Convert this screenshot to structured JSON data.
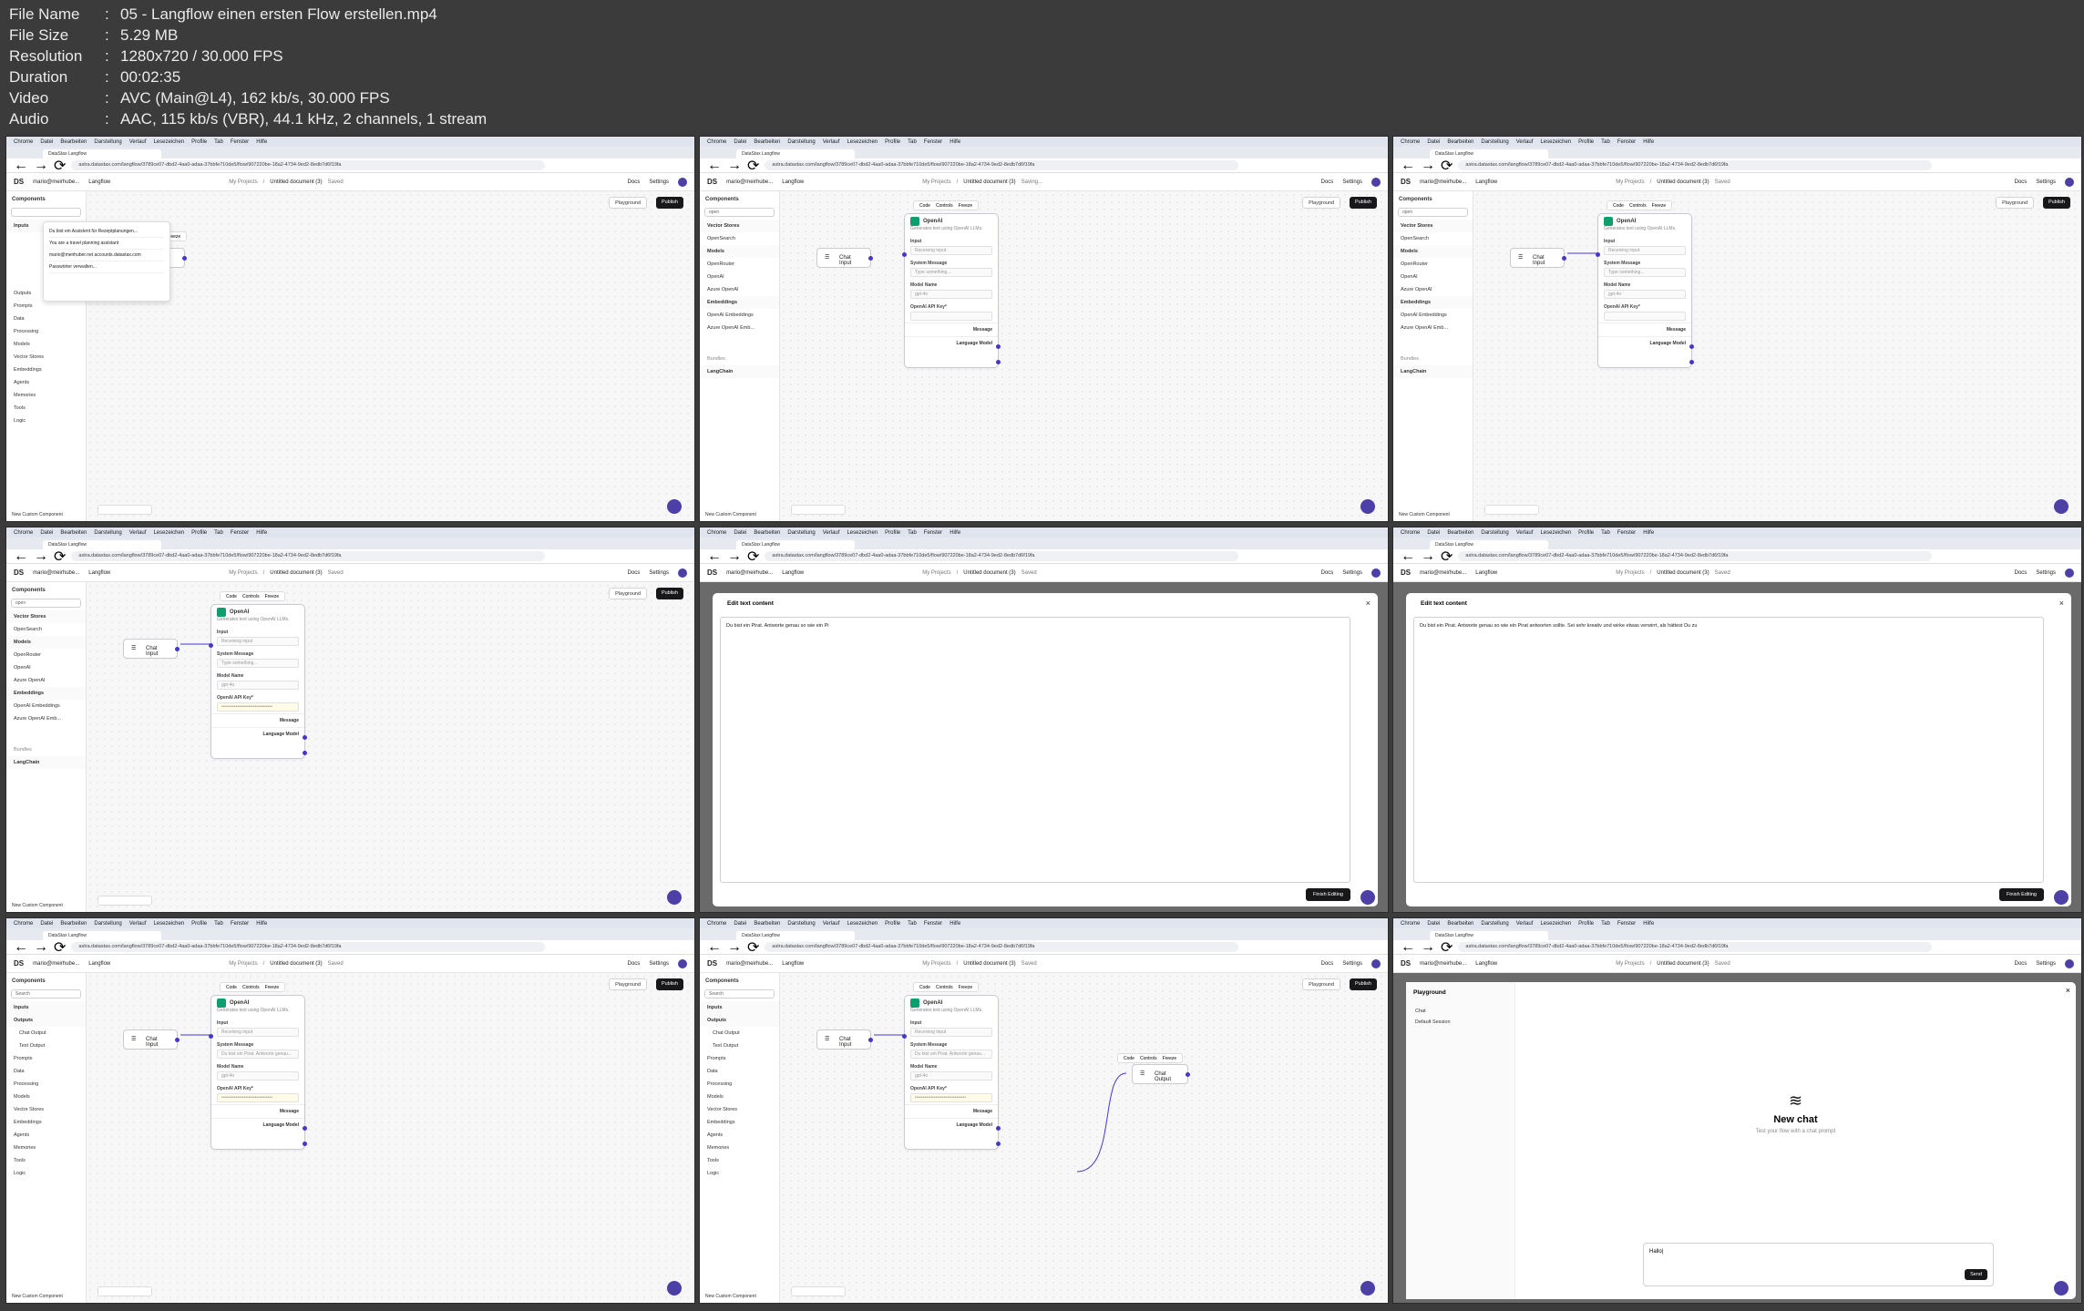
{
  "header": {
    "rows": [
      {
        "key": "File Name",
        "value": "05 - Langflow einen ersten Flow erstellen.mp4"
      },
      {
        "key": "File Size",
        "value": "5.29 MB"
      },
      {
        "key": "Resolution",
        "value": "1280x720 / 30.000 FPS"
      },
      {
        "key": "Duration",
        "value": "00:02:35"
      },
      {
        "key": "Video",
        "value": "AVC (Main@L4), 162 kb/s, 30.000 FPS"
      },
      {
        "key": "Audio",
        "value": "AAC, 115 kb/s (VBR), 44.1 kHz, 2 channels, 1 stream"
      }
    ],
    "separator": ":"
  },
  "mac_menu": [
    "Chrome",
    "Datei",
    "Bearbeiten",
    "Darstellung",
    "Verlauf",
    "Lesezeichen",
    "Profile",
    "Tab",
    "Fenster",
    "Hilfe"
  ],
  "browser": {
    "tab_title": "DataStax Langflow",
    "url": "astra.datastax.com/langflow/3789ce07-dbd2-4aa0-adaa-37bbfe710de5/flow/907220be-18a2-4734-9ed2-8edb7d6f19fa"
  },
  "app": {
    "logo": "DS",
    "account": "mario@meirhube...",
    "product": "Langflow",
    "breadcrumb_project": "My Projects",
    "doc_title": "Untitled document (3)",
    "saved": "Saved",
    "saving": "Saving...",
    "docs": "Docs",
    "settings": "Settings",
    "playground": "Playground",
    "publish": "Publish"
  },
  "sidebar": {
    "title": "Components",
    "search_placeholder": "Search",
    "search_open": "open",
    "categories": [
      "Inputs",
      "Outputs",
      "Prompts",
      "Data",
      "Processing",
      "Models",
      "Vector Stores",
      "Embeddings",
      "Agents",
      "Memories",
      "Tools",
      "Logic"
    ],
    "filtered": [
      {
        "label": "Vector Stores",
        "section": true
      },
      {
        "label": "OpenSearch",
        "section": false
      },
      {
        "label": "Models",
        "section": true
      },
      {
        "label": "OpenRouter",
        "section": false
      },
      {
        "label": "OpenAI",
        "section": false
      },
      {
        "label": "Azure OpenAI",
        "section": false
      },
      {
        "label": "Embeddings",
        "section": true
      },
      {
        "label": "OpenAI Embeddings",
        "section": false
      },
      {
        "label": "Azure OpenAI Emb...",
        "section": false
      }
    ],
    "bundles_label": "Bundles",
    "bundle_item": "LangChain",
    "outputs_expanded": [
      "Chat Output",
      "Text Output"
    ],
    "new_component": "New Custom Component"
  },
  "autocomplete": {
    "items": [
      "Du bist ein Assistent für Rezeptplanungen...",
      "You are a travel planning assistant",
      "mario@meirhuber.net  accounts.datastax.com",
      "Passwörter verwalten..."
    ]
  },
  "node_toolbar": {
    "code": "Code",
    "controls": "Controls",
    "freeze": "Freeze"
  },
  "chat_input_node": {
    "label": "Chat Input"
  },
  "chat_output_node": {
    "label": "Chat Output"
  },
  "openai_node": {
    "title": "OpenAI",
    "desc": "Generates text using OpenAI LLMs.",
    "input_label": "Input",
    "input_placeholder": "Receiving input",
    "system_label": "System Message",
    "system_placeholder": "Type something...",
    "system_value": "Du bist ein Pirat. Antworte genau...",
    "model_label": "Model Name",
    "model_value": "gpt-4o",
    "key_label": "OpenAI API Key*",
    "key_value": "••••••••••••••••••••••••••••••••",
    "out_message": "Message",
    "out_model": "Language Model"
  },
  "edit_modal": {
    "title": "Edit text content",
    "text_a": "Du bist ein Pirat. Antworte genau so wie ein Pi",
    "text_b": "Du bist ein Pirat. Antworte genau so wie ein Pirat antworten sollte. Sei sehr kreativ und wirke etwas verwirrt, als hättest Du zu",
    "finish": "Finish Editing"
  },
  "playground": {
    "title": "Playground",
    "chat": "Chat",
    "session": "Default Session",
    "new_chat": "New chat",
    "subtitle": "Test your flow with a chat prompt",
    "input_value": "Hallo|",
    "send": "Send"
  }
}
